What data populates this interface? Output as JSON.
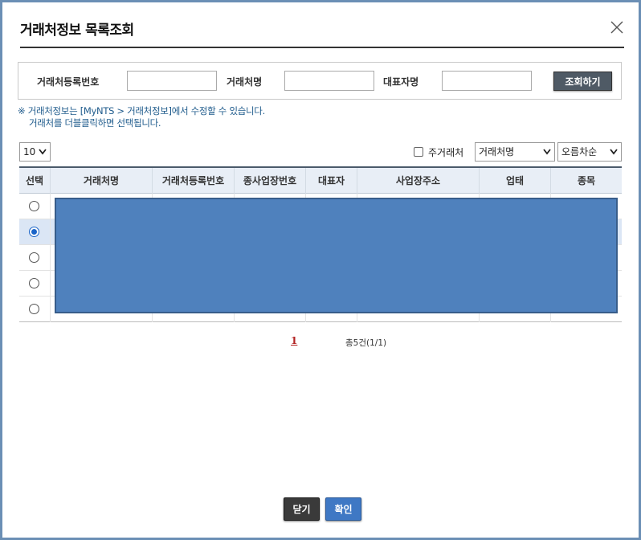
{
  "dialog": {
    "title": "거래처정보 목록조회"
  },
  "search": {
    "reg_no_label": "거래처등록번호",
    "reg_no_value": "",
    "name_label": "거래처명",
    "name_value": "",
    "rep_label": "대표자명",
    "rep_value": "",
    "search_button": "조회하기"
  },
  "notice": {
    "line1": "※ 거래처정보는 [MyNTS > 거래처정보]에서 수정할 수 있습니다.",
    "line2": "거래처를 더블클릭하면 선택됩니다."
  },
  "controls": {
    "page_size": "10",
    "main_partner_label": "주거래처",
    "main_partner_checked": false,
    "sort_field": "거래처명",
    "sort_direction": "오름차순"
  },
  "table": {
    "columns": [
      "선택",
      "거래처명",
      "거래처등록번호",
      "종사업장번호",
      "대표자",
      "사업장주소",
      "업태",
      "종목"
    ],
    "selected_row": 1,
    "row_count": 5
  },
  "pagination": {
    "current_page": "1",
    "total_text": "총5건(1/1)"
  },
  "footer": {
    "close_button": "닫기",
    "ok_button": "확인"
  },
  "colors": {
    "frame": "#6b8fb5",
    "header_bg": "#e8eef6",
    "selected_row": "#dbe6f5",
    "redaction": "#4f81bd",
    "ok_button": "#3f78c4",
    "close_button": "#3a3a3a",
    "notice_text": "#1f5b8c",
    "pager_active": "#b22222"
  }
}
